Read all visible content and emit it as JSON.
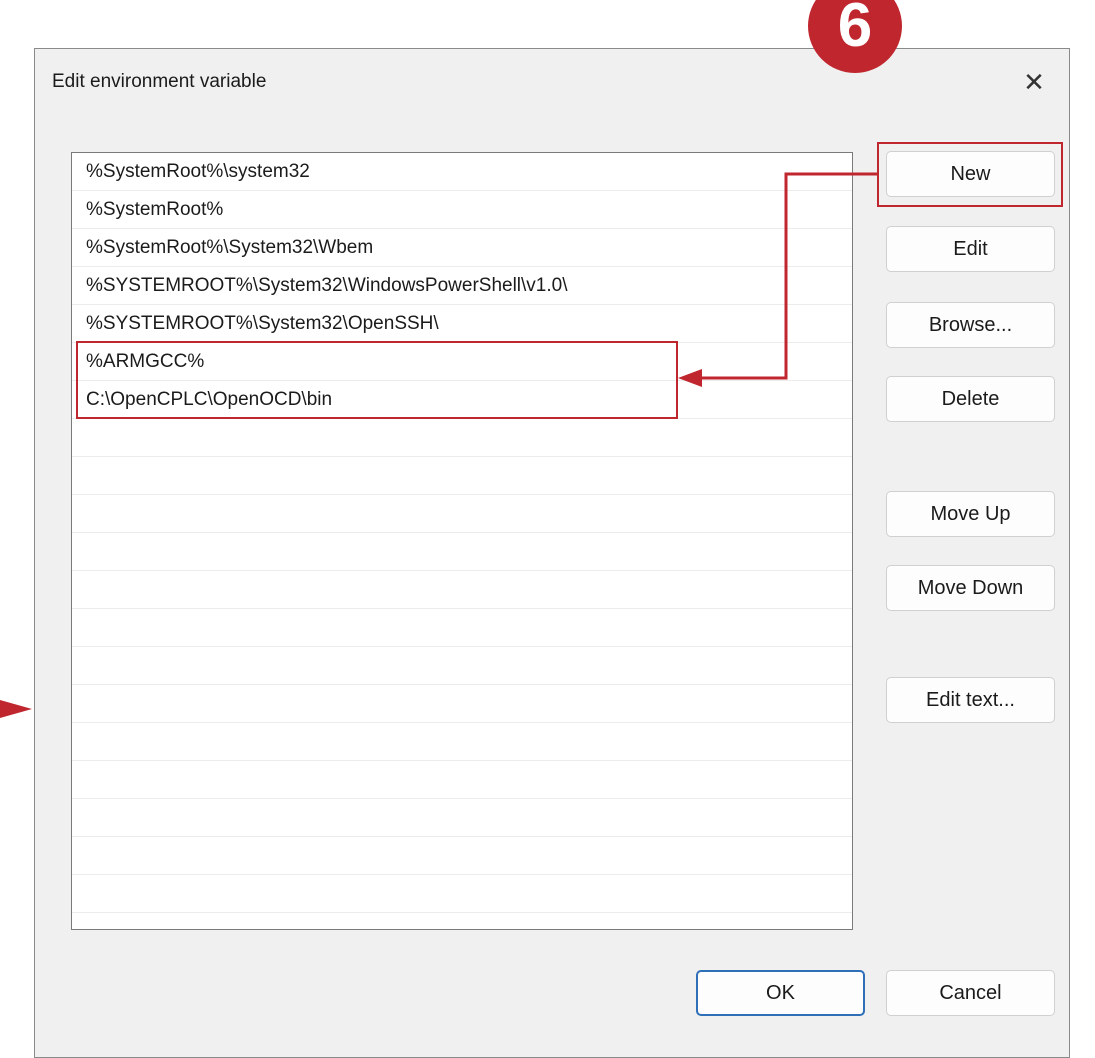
{
  "dialog": {
    "title": "Edit environment variable",
    "close_icon": "close-icon"
  },
  "entries": [
    "%SystemRoot%\\system32",
    "%SystemRoot%",
    "%SystemRoot%\\System32\\Wbem",
    "%SYSTEMROOT%\\System32\\WindowsPowerShell\\v1.0\\",
    "%SYSTEMROOT%\\System32\\OpenSSH\\",
    "%ARMGCC%",
    "C:\\OpenCPLC\\OpenOCD\\bin",
    "",
    "",
    "",
    "",
    "",
    "",
    "",
    "",
    "",
    "",
    "",
    "",
    "",
    ""
  ],
  "buttons": {
    "new": "New",
    "edit": "Edit",
    "browse": "Browse...",
    "delete": "Delete",
    "move_up": "Move Up",
    "move_down": "Move Down",
    "edit_text": "Edit text...",
    "ok": "OK",
    "cancel": "Cancel"
  },
  "annotation": {
    "step_number": "6",
    "accent_color": "#c0262e"
  }
}
